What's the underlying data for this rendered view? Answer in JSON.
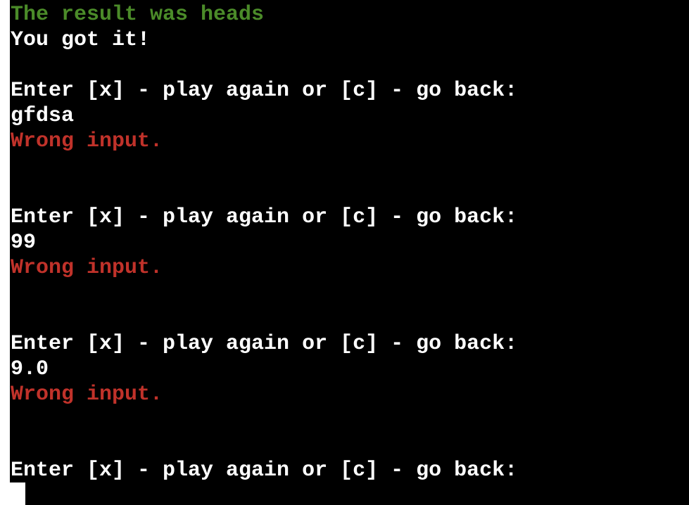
{
  "terminal": {
    "background_color": "#000000",
    "default_text_color": "#ffffff",
    "success_color": "#4b8b29",
    "error_color": "#c0322a",
    "cursor": {
      "name": "block-cursor",
      "color": "#ffffff"
    },
    "gutter": {
      "color": "#ffffff"
    },
    "lines": [
      {
        "id": "l1",
        "text": "The result was heads",
        "color": "green",
        "kind": "output"
      },
      {
        "id": "l2",
        "text": "You got it!",
        "color": "white",
        "kind": "output"
      },
      {
        "id": "l3",
        "text": "",
        "color": "white",
        "kind": "blank"
      },
      {
        "id": "l4",
        "text": "Enter [x] - play again or [c] - go back:",
        "color": "white",
        "kind": "prompt"
      },
      {
        "id": "l5",
        "text": "gfdsa",
        "color": "white",
        "kind": "user-input"
      },
      {
        "id": "l6",
        "text": "Wrong input.",
        "color": "red",
        "kind": "error"
      },
      {
        "id": "l7",
        "text": "",
        "color": "white",
        "kind": "blank"
      },
      {
        "id": "l8",
        "text": "",
        "color": "white",
        "kind": "blank"
      },
      {
        "id": "l9",
        "text": "Enter [x] - play again or [c] - go back:",
        "color": "white",
        "kind": "prompt"
      },
      {
        "id": "l10",
        "text": "99",
        "color": "white",
        "kind": "user-input"
      },
      {
        "id": "l11",
        "text": "Wrong input.",
        "color": "red",
        "kind": "error"
      },
      {
        "id": "l12",
        "text": "",
        "color": "white",
        "kind": "blank"
      },
      {
        "id": "l13",
        "text": "",
        "color": "white",
        "kind": "blank"
      },
      {
        "id": "l14",
        "text": "Enter [x] - play again or [c] - go back:",
        "color": "white",
        "kind": "prompt"
      },
      {
        "id": "l15",
        "text": "9.0",
        "color": "white",
        "kind": "user-input"
      },
      {
        "id": "l16",
        "text": "Wrong input.",
        "color": "red",
        "kind": "error"
      },
      {
        "id": "l17",
        "text": "",
        "color": "white",
        "kind": "blank"
      },
      {
        "id": "l18",
        "text": "",
        "color": "white",
        "kind": "blank"
      },
      {
        "id": "l19",
        "text": "Enter [x] - play again or [c] - go back:",
        "color": "white",
        "kind": "prompt"
      }
    ]
  }
}
